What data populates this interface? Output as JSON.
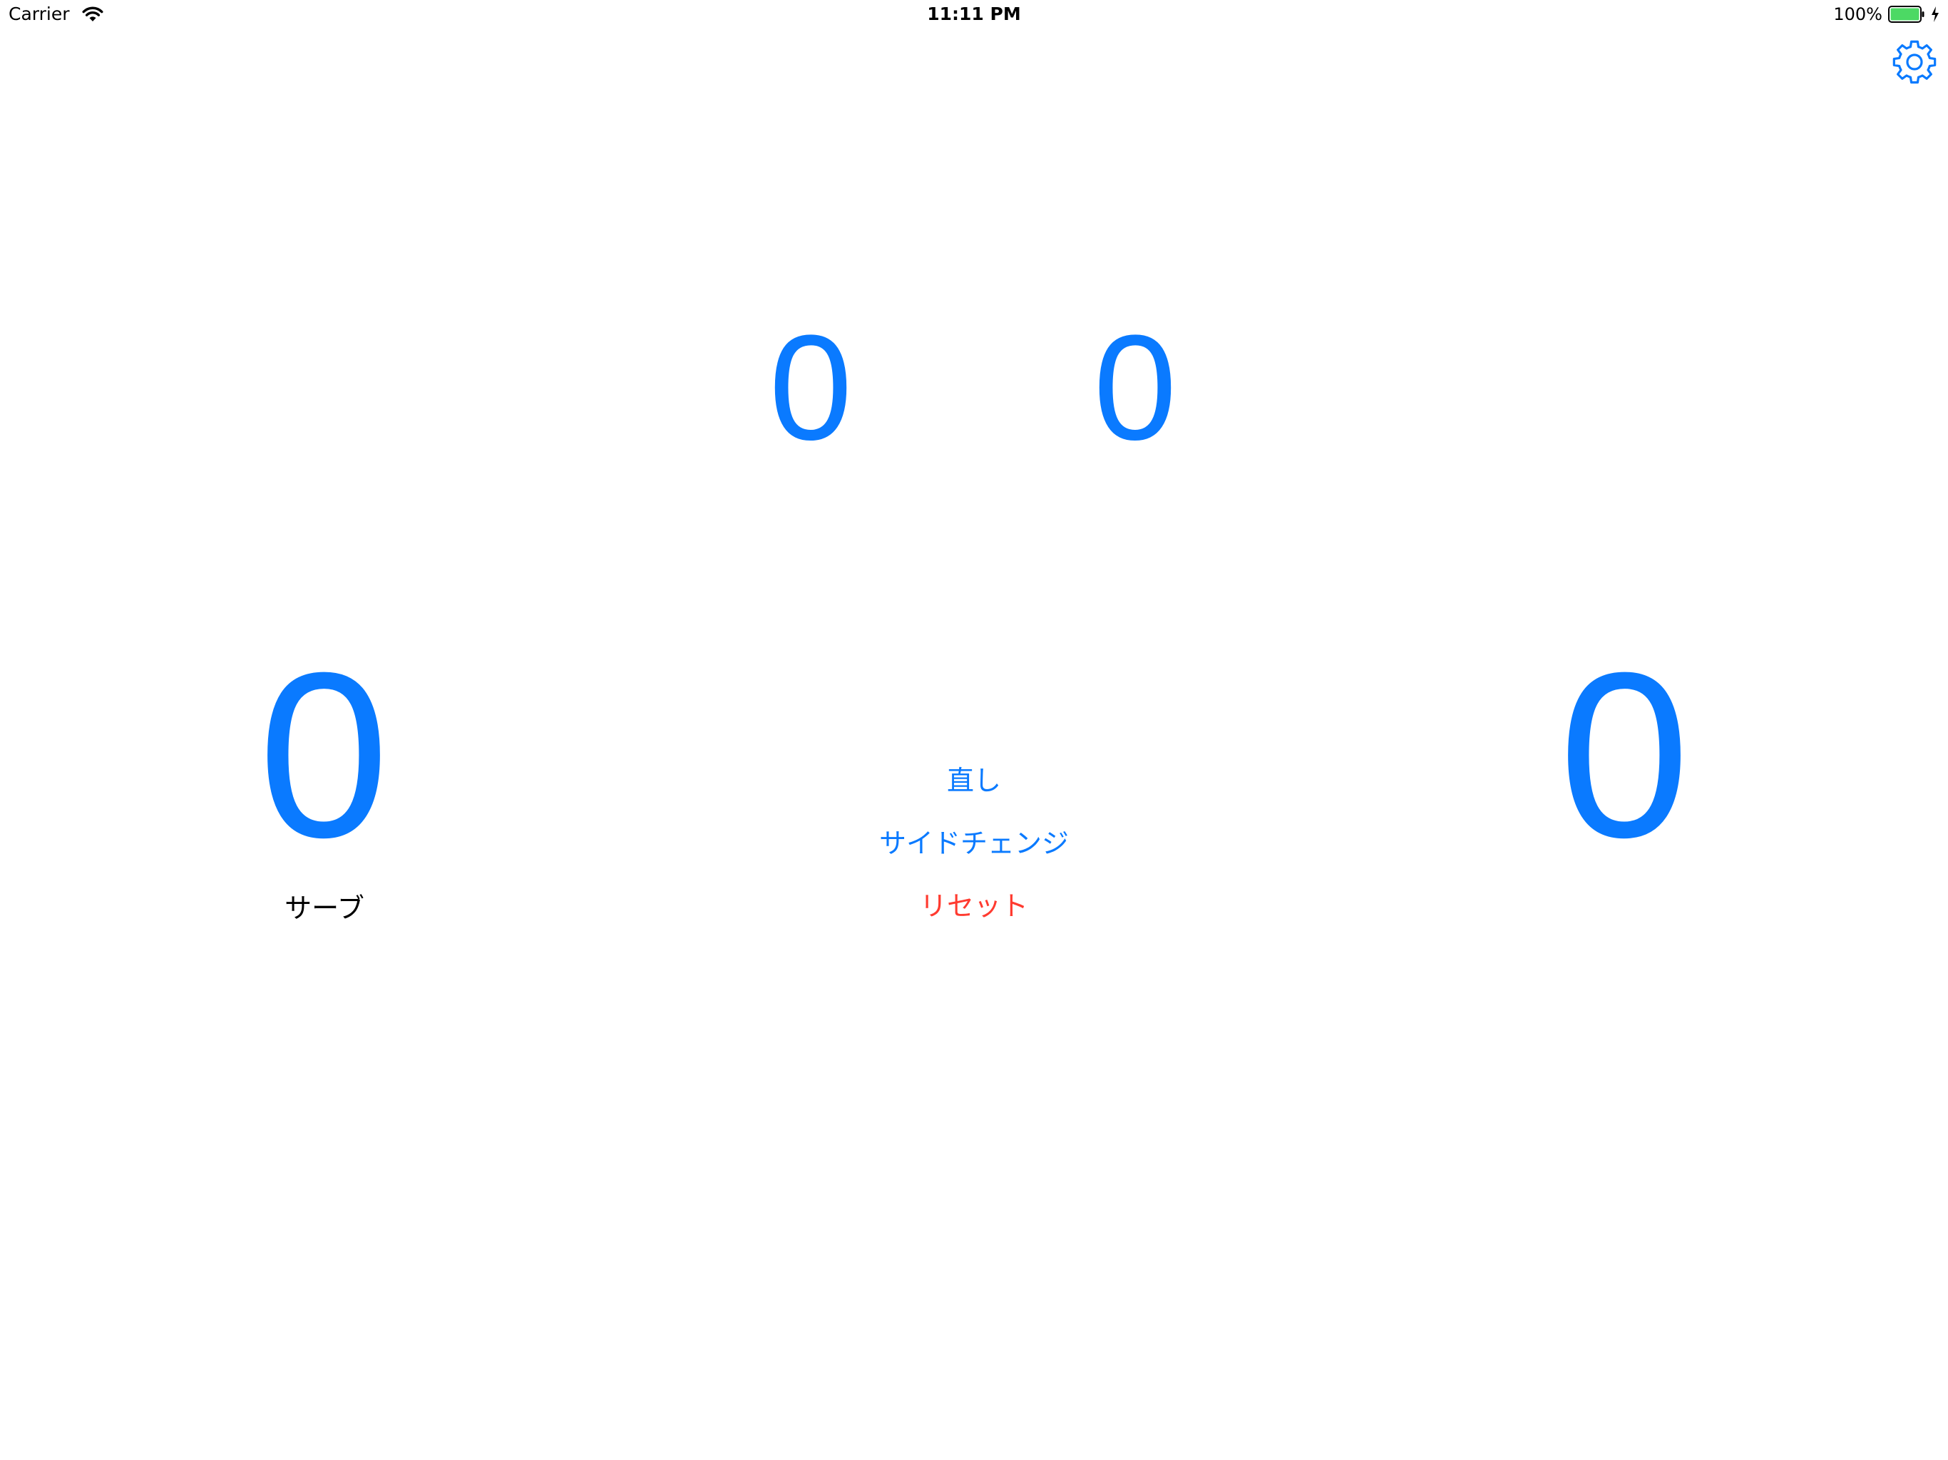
{
  "status_bar": {
    "carrier": "Carrier",
    "time": "11:11 PM",
    "battery_percent": "100%",
    "battery_level": 1.0,
    "battery_color": "#4cd964"
  },
  "toolbar": {
    "settings_icon": "gear-icon"
  },
  "scoreboard": {
    "set_score_left": "0",
    "set_score_right": "0",
    "point_score_left": "0",
    "point_score_right": "0",
    "serve_label": "サーブ"
  },
  "actions": {
    "undo_label": "直し",
    "side_change_label": "サイドチェンジ",
    "reset_label": "リセット"
  },
  "colors": {
    "accent": "#0a7aff",
    "destructive": "#ff3b30",
    "text": "#000000",
    "background": "#ffffff"
  }
}
